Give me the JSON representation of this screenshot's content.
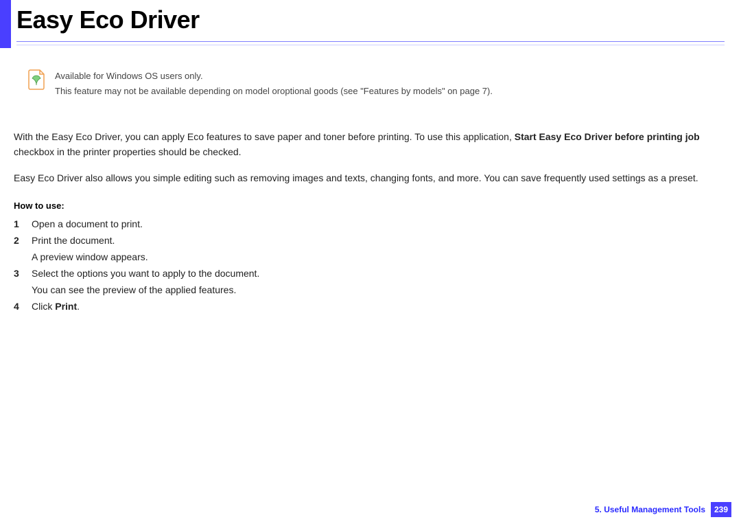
{
  "header": {
    "title": "Easy Eco Driver"
  },
  "note": {
    "line1": "Available for Windows OS users only.",
    "line2_a": "This feature may not be available depending on model or",
    "line2_b": "optional goods (see \"Features by models\" on page 7)."
  },
  "body": {
    "p1_a": "With the Easy Eco Driver, you can",
    "p1_b": "apply Eco features to",
    "p1_c": "save paper and toner before printing",
    "p1_d": ". To use this",
    "p1_e": "application,",
    "p1_bold": "Start Easy Eco Driver before printing job",
    "p1_f": "checkbox in the printer properties",
    "p1_g": "should be checked.",
    "p2_a": "Easy Eco Driver also allows you",
    "p2_b": "simple editing such as removing",
    "p2_c": "images and texts, changing fonts,",
    "p2_d": "and more. You can save frequently",
    "p2_e": "used settings as a preset."
  },
  "howto": {
    "title": "How to use:",
    "steps": [
      {
        "num": "1",
        "text": "Open a document to print."
      },
      {
        "num": "2",
        "text": "Print the document.",
        "sub": "A preview window appears."
      },
      {
        "num": "3",
        "text_a": "Select the options you want",
        "text_b": "to apply to the document.",
        "sub": "You can see the preview of the applied features."
      },
      {
        "num": "4",
        "text_a": "Click ",
        "bold": "Print",
        "text_b": "."
      }
    ]
  },
  "footer": {
    "chapter": "5.  Useful Management Tools",
    "page": "239"
  }
}
